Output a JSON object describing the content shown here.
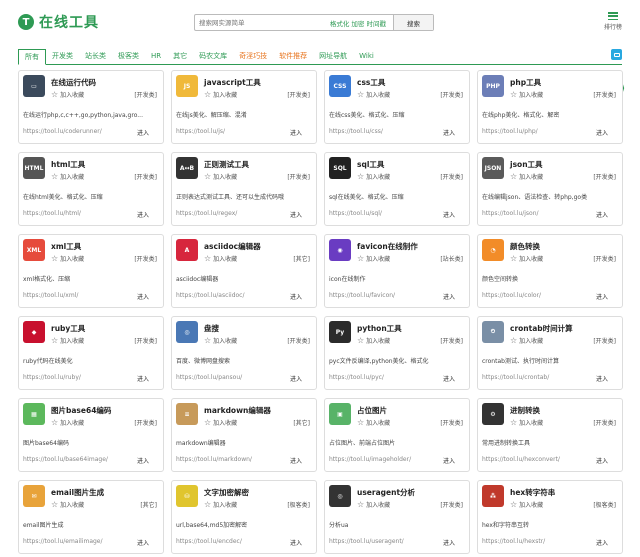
{
  "header": {
    "logo_mark": "T",
    "logo_text": "在线工具",
    "search_placeholder": "搜索网实源简单",
    "search_hints": "格式化 加密 时间戳",
    "search_button": "搜索",
    "rank_label": "排行榜"
  },
  "tabs": [
    {
      "label": "所有",
      "active": true
    },
    {
      "label": "开发类"
    },
    {
      "label": "站长类"
    },
    {
      "label": "极客类"
    },
    {
      "label": "HR"
    },
    {
      "label": "其它"
    },
    {
      "label": "码农文库"
    },
    {
      "label": "奇淫巧技",
      "orange": true
    },
    {
      "label": "软件推荐",
      "orange": true
    },
    {
      "label": "网址导航"
    },
    {
      "label": "Wiki"
    }
  ],
  "common": {
    "fav": "加入收藏",
    "go": "进入"
  },
  "colors": {
    "brand": "#2e9a54",
    "accent_orange": "#e87620"
  },
  "tools": [
    {
      "title": "在线运行代码",
      "category": "[开发类]",
      "desc": "在线运行php,c,c++,go,python,java,gro...",
      "url": "https://tool.lu/coderunner/",
      "icon": "monitor-icon",
      "color": "#3b4a5c",
      "glyph": "▭"
    },
    {
      "title": "javascript工具",
      "category": "[开发类]",
      "desc": "在线js美化、解压缩、混淆",
      "url": "https://tool.lu/js/",
      "icon": "js-file-icon",
      "color": "#f0b93a",
      "glyph": "JS"
    },
    {
      "title": "css工具",
      "category": "[开发类]",
      "desc": "在线css美化、格式化、压缩",
      "url": "https://tool.lu/css/",
      "icon": "css-file-icon",
      "color": "#3a7bd5",
      "glyph": "CSS"
    },
    {
      "title": "php工具",
      "category": "[开发类]",
      "desc": "在线php美化、格式化、解密",
      "url": "https://tool.lu/php/",
      "icon": "php-file-icon",
      "color": "#6c7eb7",
      "glyph": "PHP"
    },
    {
      "title": "html工具",
      "category": "[开发类]",
      "desc": "在线html美化、格式化、压缩",
      "url": "https://tool.lu/html/",
      "icon": "html-file-icon",
      "color": "#555555",
      "glyph": "HTML"
    },
    {
      "title": "正则测试工具",
      "category": "[开发类]",
      "desc": "正则表达式测试工具、还可以生成代码哦",
      "url": "https://tool.lu/regex/",
      "icon": "regex-icon",
      "color": "#333333",
      "glyph": "A↔B"
    },
    {
      "title": "sql工具",
      "category": "[开发类]",
      "desc": "sql在线美化、格式化、压缩",
      "url": "https://tool.lu/sql/",
      "icon": "sql-icon",
      "color": "#222222",
      "glyph": "SQL"
    },
    {
      "title": "json工具",
      "category": "[开发类]",
      "desc": "在线编辑json、语法检查、转php,go类",
      "url": "https://tool.lu/json/",
      "icon": "json-file-icon",
      "color": "#5a5a5a",
      "glyph": "JSON"
    },
    {
      "title": "xml工具",
      "category": "[开发类]",
      "desc": "xml格式化、压缩",
      "url": "https://tool.lu/xml/",
      "icon": "xml-file-icon",
      "color": "#e64b3c",
      "glyph": "XML"
    },
    {
      "title": "asciidoc编辑器",
      "category": "[其它]",
      "desc": "asciidoc编辑器",
      "url": "https://tool.lu/asciidoc/",
      "icon": "asciidoc-icon",
      "color": "#d7263d",
      "glyph": "A"
    },
    {
      "title": "favicon在线制作",
      "category": "[站长类]",
      "desc": "icon在线制作",
      "url": "https://tool.lu/favicon/",
      "icon": "favicon-icon",
      "color": "#6a3cc2",
      "glyph": "◉"
    },
    {
      "title": "颜色转换",
      "category": "[开发类]",
      "desc": "颜色空间转换",
      "url": "https://tool.lu/color/",
      "icon": "color-fan-icon",
      "color": "#f28c28",
      "glyph": "◔"
    },
    {
      "title": "ruby工具",
      "category": "[开发类]",
      "desc": "ruby代码在线美化",
      "url": "https://tool.lu/ruby/",
      "icon": "ruby-icon",
      "color": "#c8102e",
      "glyph": "◆"
    },
    {
      "title": "盘搜",
      "category": "[开发类]",
      "desc": "百度、微博网盘搜索",
      "url": "https://tool.lu/pansou/",
      "icon": "disk-icon",
      "color": "#4a78b5",
      "glyph": "◎"
    },
    {
      "title": "python工具",
      "category": "[开发类]",
      "desc": "pyc文件反编译,python美化、格式化",
      "url": "https://tool.lu/pyc/",
      "icon": "python-icon",
      "color": "#2b2b2b",
      "glyph": "Py"
    },
    {
      "title": "crontab时间计算",
      "category": "[开发类]",
      "desc": "crontab测试、执行时间计算",
      "url": "https://tool.lu/crontab/",
      "icon": "crontab-icon",
      "color": "#7a8fa6",
      "glyph": "⏲"
    },
    {
      "title": "图片base64编码",
      "category": "[开发类]",
      "desc": "图片base64编码",
      "url": "https://tool.lu/base64image/",
      "icon": "image-grid-icon",
      "color": "#5cb85c",
      "glyph": "▦"
    },
    {
      "title": "markdown编辑器",
      "category": "[其它]",
      "desc": "markdown编辑器",
      "url": "https://tool.lu/markdown/",
      "icon": "markdown-icon",
      "color": "#c79a5a",
      "glyph": "≡"
    },
    {
      "title": "占位图片",
      "category": "[开发类]",
      "desc": "占位图片、前端占位图片",
      "url": "https://tool.lu/imageholder/",
      "icon": "placeholder-image-icon",
      "color": "#58b368",
      "glyph": "▣"
    },
    {
      "title": "进制转换",
      "category": "[开发类]",
      "desc": "常用进制转换工具",
      "url": "https://tool.lu/hexconvert/",
      "icon": "convert-icon",
      "color": "#333333",
      "glyph": "⚙"
    },
    {
      "title": "email图片生成",
      "category": "[其它]",
      "desc": "email图片生成",
      "url": "https://tool.lu/emailimage/",
      "icon": "email-icon",
      "color": "#e8a33a",
      "glyph": "✉"
    },
    {
      "title": "文字加密解密",
      "category": "[极客类]",
      "desc": "url,base64,md5加密解密",
      "url": "https://tool.lu/encdec/",
      "icon": "encrypt-icon",
      "color": "#e0c52e",
      "glyph": "⛁"
    },
    {
      "title": "useragent分析",
      "category": "[开发类]",
      "desc": "分析ua",
      "url": "https://tool.lu/useragent/",
      "icon": "chrome-icon",
      "color": "#333333",
      "glyph": "◎"
    },
    {
      "title": "hex转字符串",
      "category": "[极客类]",
      "desc": "hex和字符串互转",
      "url": "https://tool.lu/hexstr/",
      "icon": "hex-dots-icon",
      "color": "#c0392b",
      "glyph": "⁂"
    }
  ]
}
